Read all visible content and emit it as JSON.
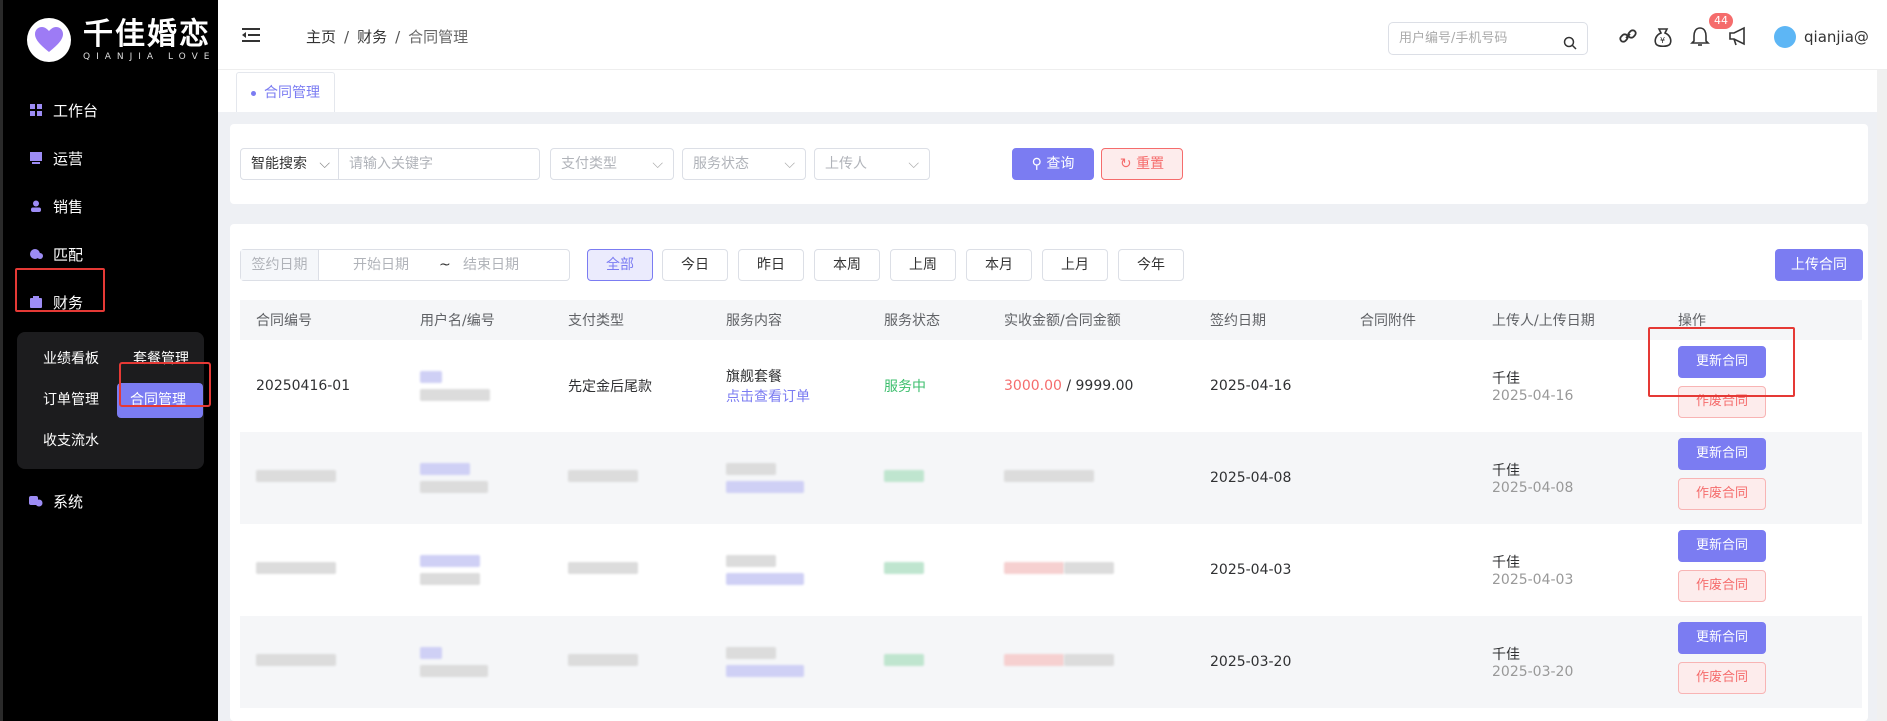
{
  "brand": {
    "name": "千佳婚恋",
    "subtitle": "QIANJIA LOVE",
    "heart_color": "#9d7bf5"
  },
  "sidebar": {
    "items": [
      {
        "label": "工作台",
        "icon": "grid-icon"
      },
      {
        "label": "运营",
        "icon": "monitor-icon"
      },
      {
        "label": "销售",
        "icon": "user-icon"
      },
      {
        "label": "匹配",
        "icon": "match-icon"
      },
      {
        "label": "财务",
        "icon": "wallet-icon"
      },
      {
        "label": "系统",
        "icon": "settings-icon"
      }
    ],
    "finance_sub": [
      "业绩看板",
      "套餐管理",
      "订单管理",
      "合同管理",
      "收支流水"
    ]
  },
  "header": {
    "breadcrumb": [
      "主页",
      "财务",
      "合同管理"
    ],
    "search_placeholder": "用户编号/手机号码",
    "notification_count": "44",
    "username": "qianjia@"
  },
  "tabs": [
    {
      "label": "合同管理"
    }
  ],
  "filters": {
    "smart_search": "智能搜索",
    "keyword_placeholder": "请输入关键字",
    "pay_type": "支付类型",
    "service_status": "服务状态",
    "uploader": "上传人",
    "query": "查询",
    "reset": "重置"
  },
  "date_filter": {
    "label": "签约日期",
    "start": "开始日期",
    "end": "结束日期",
    "tilde": "~",
    "quick": [
      "全部",
      "今日",
      "昨日",
      "本周",
      "上周",
      "本月",
      "上月",
      "今年"
    ],
    "upload": "上传合同"
  },
  "table": {
    "columns": [
      "合同编号",
      "用户名/编号",
      "支付类型",
      "服务内容",
      "服务状态",
      "实收金额/合同金额",
      "签约日期",
      "合同附件",
      "上传人/上传日期",
      "操作"
    ],
    "rows": [
      {
        "contract_no": "20250416-01",
        "pay_type": "先定金后尾款",
        "service": "旗舰套餐",
        "service_link": "点击查看订单",
        "status": "服务中",
        "paid": "3000.00",
        "total": " / 9999.00",
        "sign_date": "2025-04-16",
        "uploader": "千佳",
        "upload_date": "2025-04-16"
      },
      {
        "sign_date": "2025-04-08",
        "uploader": "千佳",
        "upload_date": "2025-04-08"
      },
      {
        "sign_date": "2025-04-03",
        "uploader": "千佳",
        "upload_date": "2025-04-03"
      },
      {
        "sign_date": "2025-03-20",
        "uploader": "千佳",
        "upload_date": "2025-03-20"
      }
    ],
    "update_label": "更新合同",
    "void_label": "作废合同"
  },
  "colors": {
    "accent": "#7b7cf2",
    "danger": "#f56c6c",
    "success": "#3dbf6e"
  }
}
